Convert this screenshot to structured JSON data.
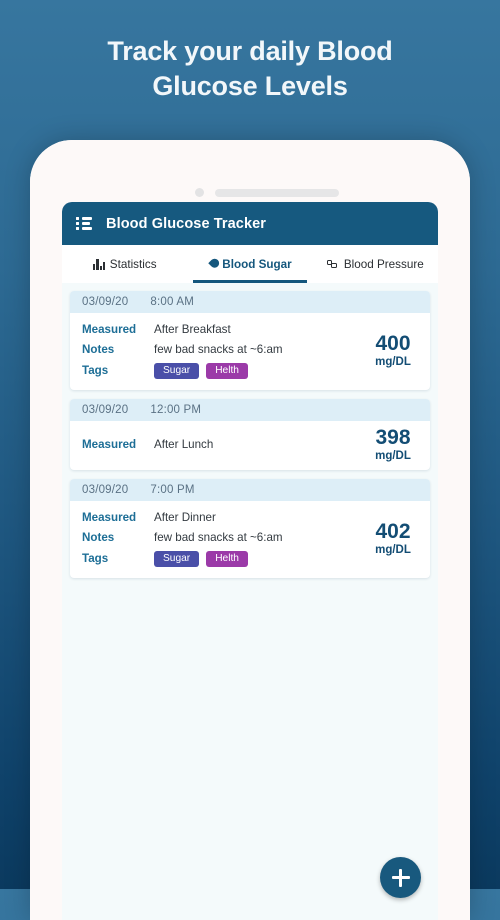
{
  "promo": {
    "headline_line1": "Track your daily Blood",
    "headline_line2": "Glucose Levels"
  },
  "app": {
    "title": "Blood Glucose Tracker",
    "menu_icon": "list-icon",
    "accent_color": "#16597f",
    "tabs": [
      {
        "label": "Statistics",
        "icon": "bar-chart-icon",
        "active": false
      },
      {
        "label": "Blood Sugar",
        "icon": "droplet-icon",
        "active": true
      },
      {
        "label": "Blood Pressure",
        "icon": "blood-pressure-icon",
        "active": false
      }
    ],
    "labels": {
      "measured": "Measured",
      "notes": "Notes",
      "tags": "Tags"
    },
    "unit": "mg/DL",
    "add_button_icon": "plus-icon",
    "entries": [
      {
        "date": "03/09/20",
        "time": "8:00 AM",
        "measured": "After Breakfast",
        "notes": "few bad snacks at ~6:am",
        "tags": [
          {
            "label": "Sugar",
            "color": "#4a4fa8"
          },
          {
            "label": "Helth",
            "color": "#9b3aa8"
          }
        ],
        "value": "400"
      },
      {
        "date": "03/09/20",
        "time": "12:00 PM",
        "measured": "After Lunch",
        "notes": null,
        "tags": [],
        "value": "398"
      },
      {
        "date": "03/09/20",
        "time": "7:00 PM",
        "measured": "After Dinner",
        "notes": "few bad snacks at ~6:am",
        "tags": [
          {
            "label": "Sugar",
            "color": "#4a4fa8"
          },
          {
            "label": "Helth",
            "color": "#9b3aa8"
          }
        ],
        "value": "402"
      }
    ]
  }
}
